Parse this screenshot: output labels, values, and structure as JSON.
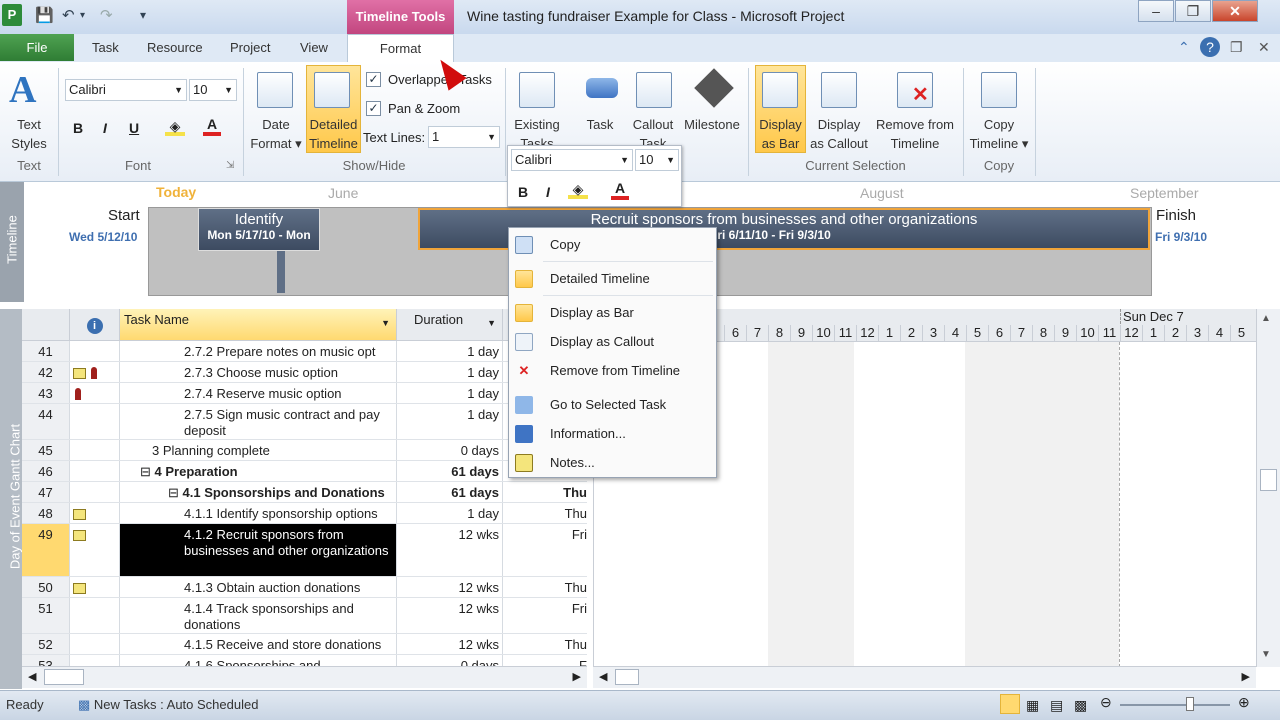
{
  "titlebar": {
    "context_tab": "Timeline Tools",
    "window_title": "Wine tasting fundraiser Example for Class  -  Microsoft Project",
    "app_icon": "P"
  },
  "tabs": [
    "File",
    "Task",
    "Resource",
    "Project",
    "View",
    "Format"
  ],
  "ribbon": {
    "text_styles": [
      "Text",
      "Styles"
    ],
    "font": {
      "family": "Calibri",
      "size": "10",
      "bold": "B",
      "italic": "I",
      "underline": "U",
      "font_color": "A"
    },
    "date_format": [
      "Date",
      "Format"
    ],
    "detailed_timeline": [
      "Detailed",
      "Timeline"
    ],
    "overlapped_tasks": "Overlapped Tasks",
    "pan_zoom": "Pan & Zoom",
    "text_lines_label": "Text Lines:",
    "text_lines_value": "1",
    "existing_tasks": [
      "Existing",
      "Tasks"
    ],
    "task": "Task",
    "callout_task": [
      "Callout",
      "Task"
    ],
    "milestone": "Milestone",
    "display_as_bar": [
      "Display",
      "as Bar"
    ],
    "display_as_callout": [
      "Display",
      "as Callout"
    ],
    "remove_from_timeline": [
      "Remove from",
      "Timeline"
    ],
    "copy_timeline": [
      "Copy",
      "Timeline"
    ],
    "groups": [
      "Text",
      "Font",
      "Show/Hide",
      "Current Selection",
      "Copy"
    ]
  },
  "timeline": {
    "side_label": "Timeline",
    "today": "Today",
    "months": [
      "June",
      "August",
      "September"
    ],
    "start_label": "Start",
    "start_date": "Wed 5/12/10",
    "finish_label": "Finish",
    "finish_date": "Fri 9/3/10",
    "bar1_title": "Identify",
    "bar1_dates": "Mon 5/17/10 - Mon",
    "bar2_title": "Recruit sponsors from businesses and other organizations",
    "bar2_dates": "Fri 6/11/10 - Fri 9/3/10"
  },
  "gantt": {
    "side_label": "Day of Event Gantt Chart",
    "headers": {
      "info": "i",
      "task_name": "Task Name",
      "duration": "Duration"
    },
    "rows": [
      {
        "id": "41",
        "name": "2.7.2 Prepare notes on music opt",
        "duration": "1 day",
        "start": ""
      },
      {
        "id": "42",
        "name": "2.7.3 Choose music option",
        "duration": "1 day",
        "start": ""
      },
      {
        "id": "43",
        "name": "2.7.4 Reserve music option",
        "duration": "1 day",
        "start": ""
      },
      {
        "id": "44",
        "name": "2.7.5 Sign music contract and pay deposit",
        "duration": "1 day",
        "start": ""
      },
      {
        "id": "45",
        "name": "3 Planning complete",
        "duration": "0 days",
        "start": ""
      },
      {
        "id": "46",
        "name": "4 Preparation",
        "duration": "61 days",
        "start": ""
      },
      {
        "id": "47",
        "name": "4.1 Sponsorships and Donations",
        "duration": "61 days",
        "start": "Thu"
      },
      {
        "id": "48",
        "name": "4.1.1 Identify sponsorship options",
        "duration": "1 day",
        "start": "Thu"
      },
      {
        "id": "49",
        "name": "4.1.2 Recruit sponsors from businesses and other organizations",
        "duration": "12 wks",
        "start": "Fri"
      },
      {
        "id": "50",
        "name": "4.1.3 Obtain auction donations",
        "duration": "12 wks",
        "start": "Thu"
      },
      {
        "id": "51",
        "name": "4.1.4 Track sponsorships and donations",
        "duration": "12 wks",
        "start": "Fri"
      },
      {
        "id": "52",
        "name": "4.1.5 Receive and store donations",
        "duration": "12 wks",
        "start": "Thu"
      },
      {
        "id": "53",
        "name": "4.1.6 Sponsorships and",
        "duration": "0 days",
        "start": "F"
      }
    ],
    "chart_week": "Sun Dec 7",
    "day_cells": [
      "6",
      "7",
      "8",
      "9",
      "10",
      "11",
      "12",
      "1",
      "2",
      "3",
      "4",
      "5",
      "6",
      "7",
      "8",
      "9",
      "10",
      "11",
      "12",
      "1",
      "2",
      "3",
      "4",
      "5"
    ]
  },
  "mini_toolbar": {
    "font": "Calibri",
    "size": "10",
    "bold": "B",
    "italic": "I",
    "font_color": "A"
  },
  "context_menu": [
    "Copy",
    "Detailed Timeline",
    "Display as Bar",
    "Display as Callout",
    "Remove from Timeline",
    "Go to Selected Task",
    "Information...",
    "Notes..."
  ],
  "status": {
    "ready": "Ready",
    "new_tasks": "New Tasks : Auto Scheduled"
  }
}
